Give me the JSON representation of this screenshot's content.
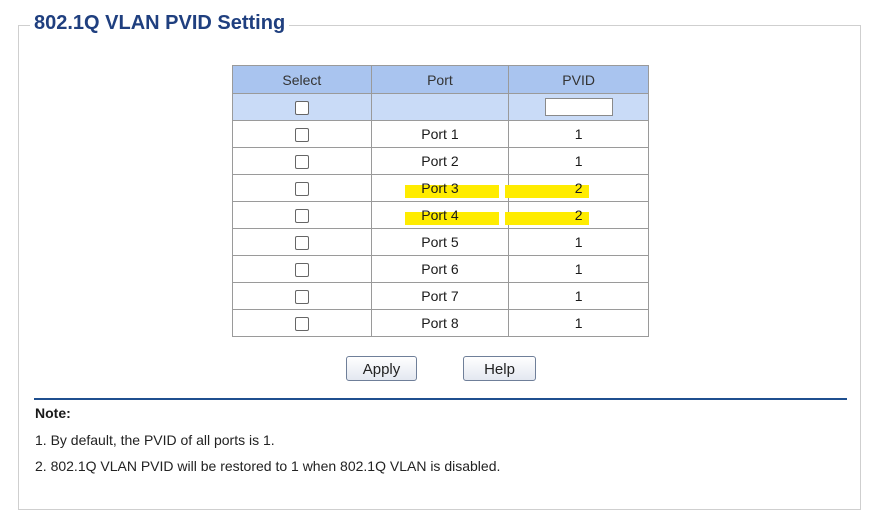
{
  "section": {
    "title": "802.1Q VLAN PVID Setting"
  },
  "table": {
    "headers": {
      "select": "Select",
      "port": "Port",
      "pvid": "PVID"
    },
    "all_pvid_value": "",
    "rows": [
      {
        "port": "Port 1",
        "pvid": "1",
        "highlighted": false
      },
      {
        "port": "Port 2",
        "pvid": "1",
        "highlighted": false
      },
      {
        "port": "Port 3",
        "pvid": "2",
        "highlighted": true
      },
      {
        "port": "Port 4",
        "pvid": "2",
        "highlighted": true
      },
      {
        "port": "Port 5",
        "pvid": "1",
        "highlighted": false
      },
      {
        "port": "Port 6",
        "pvid": "1",
        "highlighted": false
      },
      {
        "port": "Port 7",
        "pvid": "1",
        "highlighted": false
      },
      {
        "port": "Port 8",
        "pvid": "1",
        "highlighted": false
      }
    ]
  },
  "buttons": {
    "apply": "Apply",
    "help": "Help"
  },
  "note": {
    "title": "Note:",
    "lines": [
      "1. By default, the PVID of all ports is 1.",
      "2. 802.1Q VLAN PVID will be restored to 1 when 802.1Q VLAN is disabled."
    ]
  },
  "colors": {
    "title": "#1f3f7f",
    "header_bg": "#a9c4ef",
    "subheader_bg": "#c9dbf7",
    "highlight": "#ffec00",
    "divider": "#1f4f8f"
  }
}
